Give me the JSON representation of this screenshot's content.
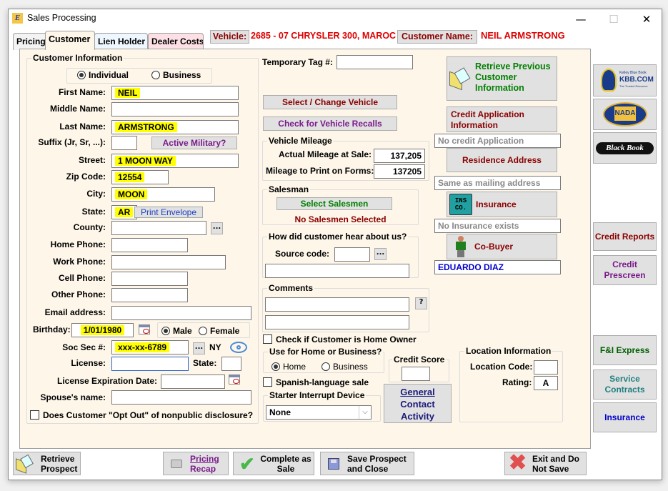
{
  "window": {
    "title": "Sales Processing",
    "app_icon": "ez-logo-icon",
    "controls": {
      "minimize": "—",
      "maximize": "☐",
      "close": "✕"
    }
  },
  "tabs": [
    {
      "label": "Pricing",
      "active": false
    },
    {
      "label": "Customer",
      "active": true
    },
    {
      "label": "Lien Holder",
      "active": false
    },
    {
      "label": "Dealer Costs",
      "active": false
    }
  ],
  "header": {
    "vehicle_button": "Vehicle:",
    "vehicle_value": "2685 - 07 CHRYSLER 300, MAROC",
    "customer_name_button": "Customer Name:",
    "customer_name_value": "NEIL ARMSTRONG"
  },
  "customer_info": {
    "group_title": "Customer Information",
    "type_options": [
      {
        "label": "Individual",
        "selected": true
      },
      {
        "label": "Business",
        "selected": false
      }
    ],
    "fields": {
      "first_name": {
        "label": "First Name:",
        "value": "NEIL"
      },
      "middle_name": {
        "label": "Middle Name:",
        "value": ""
      },
      "last_name": {
        "label": "Last Name:",
        "value": "ARMSTRONG"
      },
      "suffix": {
        "label": "Suffix (Jr, Sr, ...):",
        "value": ""
      },
      "street": {
        "label": "Street:",
        "value": "1 MOON WAY"
      },
      "zip": {
        "label": "Zip Code:",
        "value": "12554"
      },
      "city": {
        "label": "City:",
        "value": "MOON"
      },
      "state": {
        "label": "State:",
        "value": "AR"
      },
      "county": {
        "label": "County:",
        "value": ""
      },
      "home_phone": {
        "label": "Home Phone:",
        "value": ""
      },
      "work_phone": {
        "label": "Work Phone:",
        "value": ""
      },
      "cell_phone": {
        "label": "Cell Phone:",
        "value": ""
      },
      "other_phone": {
        "label": "Other Phone:",
        "value": ""
      },
      "email": {
        "label": "Email address:",
        "value": ""
      },
      "birthday": {
        "label": "Birthday:",
        "value": "1/01/1980"
      },
      "ssn": {
        "label": "Soc Sec #:",
        "value": "xxx-xx-6789",
        "state_tag": "NY"
      },
      "license": {
        "label": "License:",
        "value": ""
      },
      "license_state": {
        "label": "State:",
        "value": ""
      },
      "license_exp": {
        "label": "License Expiration Date:",
        "value": ""
      },
      "spouse": {
        "label": "Spouse's name:",
        "value": ""
      }
    },
    "active_military_button": "Active Military?",
    "print_envelope_button": "Print Envelope",
    "gender_options": [
      {
        "label": "Male",
        "selected": true
      },
      {
        "label": "Female",
        "selected": false
      }
    ],
    "opt_out_label": "Does Customer \"Opt Out\" of nonpublic disclosure?",
    "opt_out_checked": false,
    "ellipsis": "..."
  },
  "middle": {
    "temp_tag_label": "Temporary Tag #:",
    "temp_tag_value": "",
    "select_vehicle_button": "Select / Change Vehicle",
    "check_recalls_button": "Check for Vehicle Recalls",
    "mileage": {
      "title": "Vehicle Mileage",
      "actual_label": "Actual Mileage at Sale:",
      "actual_value": "137,205",
      "print_label": "Mileage to Print on Forms:",
      "print_value": "137205"
    },
    "salesman": {
      "title": "Salesman",
      "select_button": "Select Salesmen",
      "status": "No Salesmen Selected"
    },
    "source": {
      "title": "How did customer hear about us?",
      "code_label": "Source code:",
      "code_value": "",
      "description": ""
    },
    "comments": {
      "title": "Comments",
      "line1": "",
      "line2": "",
      "help": "?"
    },
    "home_owner_label": "Check if Customer is Home Owner",
    "home_owner_checked": false,
    "use_for": {
      "title": "Use for Home or Business?",
      "options": [
        {
          "label": "Home",
          "selected": true
        },
        {
          "label": "Business",
          "selected": false
        }
      ]
    },
    "credit_score": {
      "title": "Credit Score",
      "value": ""
    },
    "spanish_label": "Spanish-language sale",
    "spanish_checked": false,
    "starter": {
      "title": "Starter Interrupt Device",
      "selected": "None"
    },
    "general_contact_button": [
      "General",
      "Contact",
      "Activity"
    ]
  },
  "right": {
    "retrieve_previous_button": [
      "Retrieve Previous",
      "Customer",
      "Information"
    ],
    "credit_app_button": [
      "Credit Application",
      "Information"
    ],
    "credit_app_status": "No credit Application",
    "residence_button": "Residence Address",
    "residence_status": "Same as mailing address",
    "insurance_button": "Insurance",
    "insurance_status": "No Insurance exists",
    "cobuyer_button": "Co-Buyer",
    "cobuyer_value": "EDUARDO DIAZ",
    "location": {
      "title": "Location Information",
      "code_label": "Location Code:",
      "code_value": "",
      "rating_label": "Rating:",
      "rating_value": "A"
    }
  },
  "sidebar": {
    "kbb": {
      "line1": "Kelley Blue Book",
      "line2": "KBB.COM",
      "line3": "The Trusted Resource"
    },
    "nada": "NADA",
    "blackbook": "Black Book",
    "credit_reports": "Credit Reports",
    "credit_prescreen": [
      "Credit",
      "Prescreen"
    ],
    "fi_express": "F&I Express",
    "service_contracts": [
      "Service",
      "Contracts"
    ],
    "insurance": "Insurance"
  },
  "footer": {
    "retrieve_prospect": [
      "Retrieve",
      "Prospect"
    ],
    "pricing_recap": [
      "Pricing",
      "Recap"
    ],
    "complete_sale": [
      "Complete as",
      "Sale"
    ],
    "save_prospect": [
      "Save Prospect",
      "and Close"
    ],
    "exit": [
      "Exit and Do",
      "Not Save"
    ]
  },
  "colors": {
    "panel_bg": "#fdf6e9",
    "highlight": "#ffff00",
    "header_red": "#e00000",
    "dark_red": "#8b0000",
    "green": "#008000",
    "purple": "#7a1a8a",
    "blue": "#0000cc"
  }
}
